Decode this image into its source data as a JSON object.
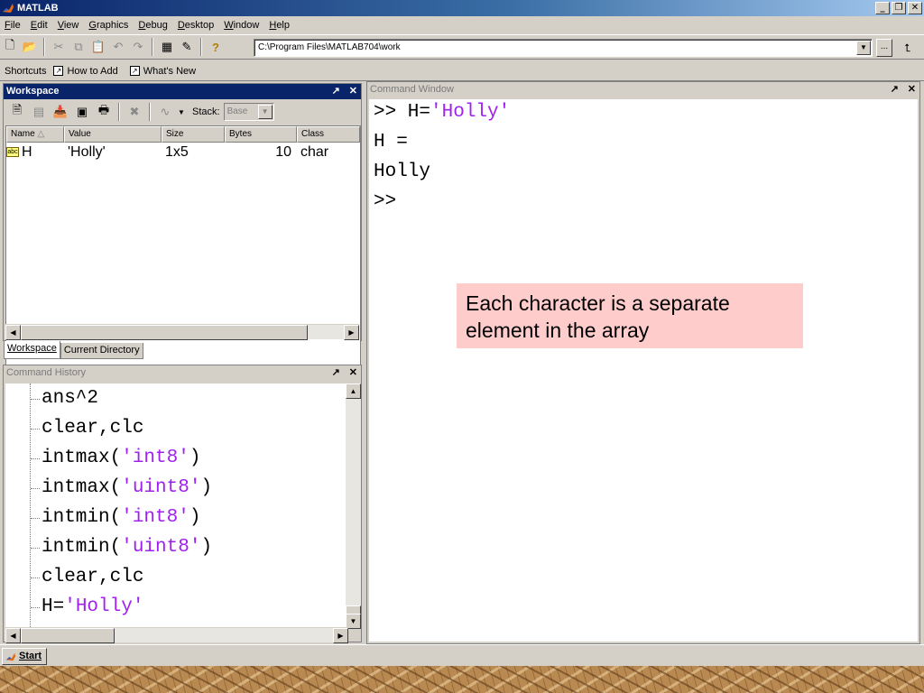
{
  "window": {
    "title": "MATLAB"
  },
  "menu": [
    {
      "label": "File",
      "name": "menu-file"
    },
    {
      "label": "Edit",
      "name": "menu-edit"
    },
    {
      "label": "View",
      "name": "menu-view"
    },
    {
      "label": "Graphics",
      "name": "menu-graphics"
    },
    {
      "label": "Debug",
      "name": "menu-debug"
    },
    {
      "label": "Desktop",
      "name": "menu-desktop"
    },
    {
      "label": "Window",
      "name": "menu-window"
    },
    {
      "label": "Help",
      "name": "menu-help"
    }
  ],
  "toolbar": {
    "current_directory": "C:\\Program Files\\MATLAB704\\work",
    "browse_label": "...",
    "icons": [
      "new-file-icon",
      "open-folder-icon",
      "cut-icon",
      "copy-icon",
      "paste-icon",
      "undo-icon",
      "redo-icon",
      "simulink-icon",
      "guide-icon",
      "help-icon"
    ]
  },
  "shortcuts": {
    "label": "Shortcuts",
    "items": [
      "How to Add",
      "What's New"
    ]
  },
  "workspace": {
    "title": "Workspace",
    "stack_label": "Stack:",
    "stack_value": "Base",
    "columns": [
      "Name",
      "Value",
      "Size",
      "Bytes",
      "Class"
    ],
    "rows": [
      {
        "name": "H",
        "value": "'Holly'",
        "size": "1x5",
        "bytes": "10",
        "class": "char",
        "type_icon": "abc"
      }
    ],
    "tabs": [
      "Workspace",
      "Current Directory"
    ]
  },
  "history": {
    "title": "Command History",
    "lines": [
      {
        "code": "ans^2",
        "str": "",
        "tail": ""
      },
      {
        "code": "clear,clc",
        "str": "",
        "tail": ""
      },
      {
        "code": "intmax(",
        "str": "'int8'",
        "tail": ")"
      },
      {
        "code": "intmax(",
        "str": "'uint8'",
        "tail": ")"
      },
      {
        "code": "intmin(",
        "str": "'int8'",
        "tail": ")"
      },
      {
        "code": "intmin(",
        "str": "'uint8'",
        "tail": ")"
      },
      {
        "code": "clear,clc",
        "str": "",
        "tail": ""
      },
      {
        "code": "H=",
        "str": "'Holly'",
        "tail": ""
      }
    ]
  },
  "command_window": {
    "title": "Command Window",
    "lines": [
      {
        "code": ">> H=",
        "str": "'Holly'"
      },
      {
        "code": "H =",
        "str": ""
      },
      {
        "code": "Holly",
        "str": ""
      },
      {
        "code": ">>",
        "str": ""
      }
    ],
    "callout": "Each character is a separate element in the array"
  },
  "taskbar": {
    "start_label": "Start"
  },
  "colors": {
    "active_title": "#0a246a",
    "string_literal": "#a020f0",
    "callout_bg": "#ffcccc"
  }
}
